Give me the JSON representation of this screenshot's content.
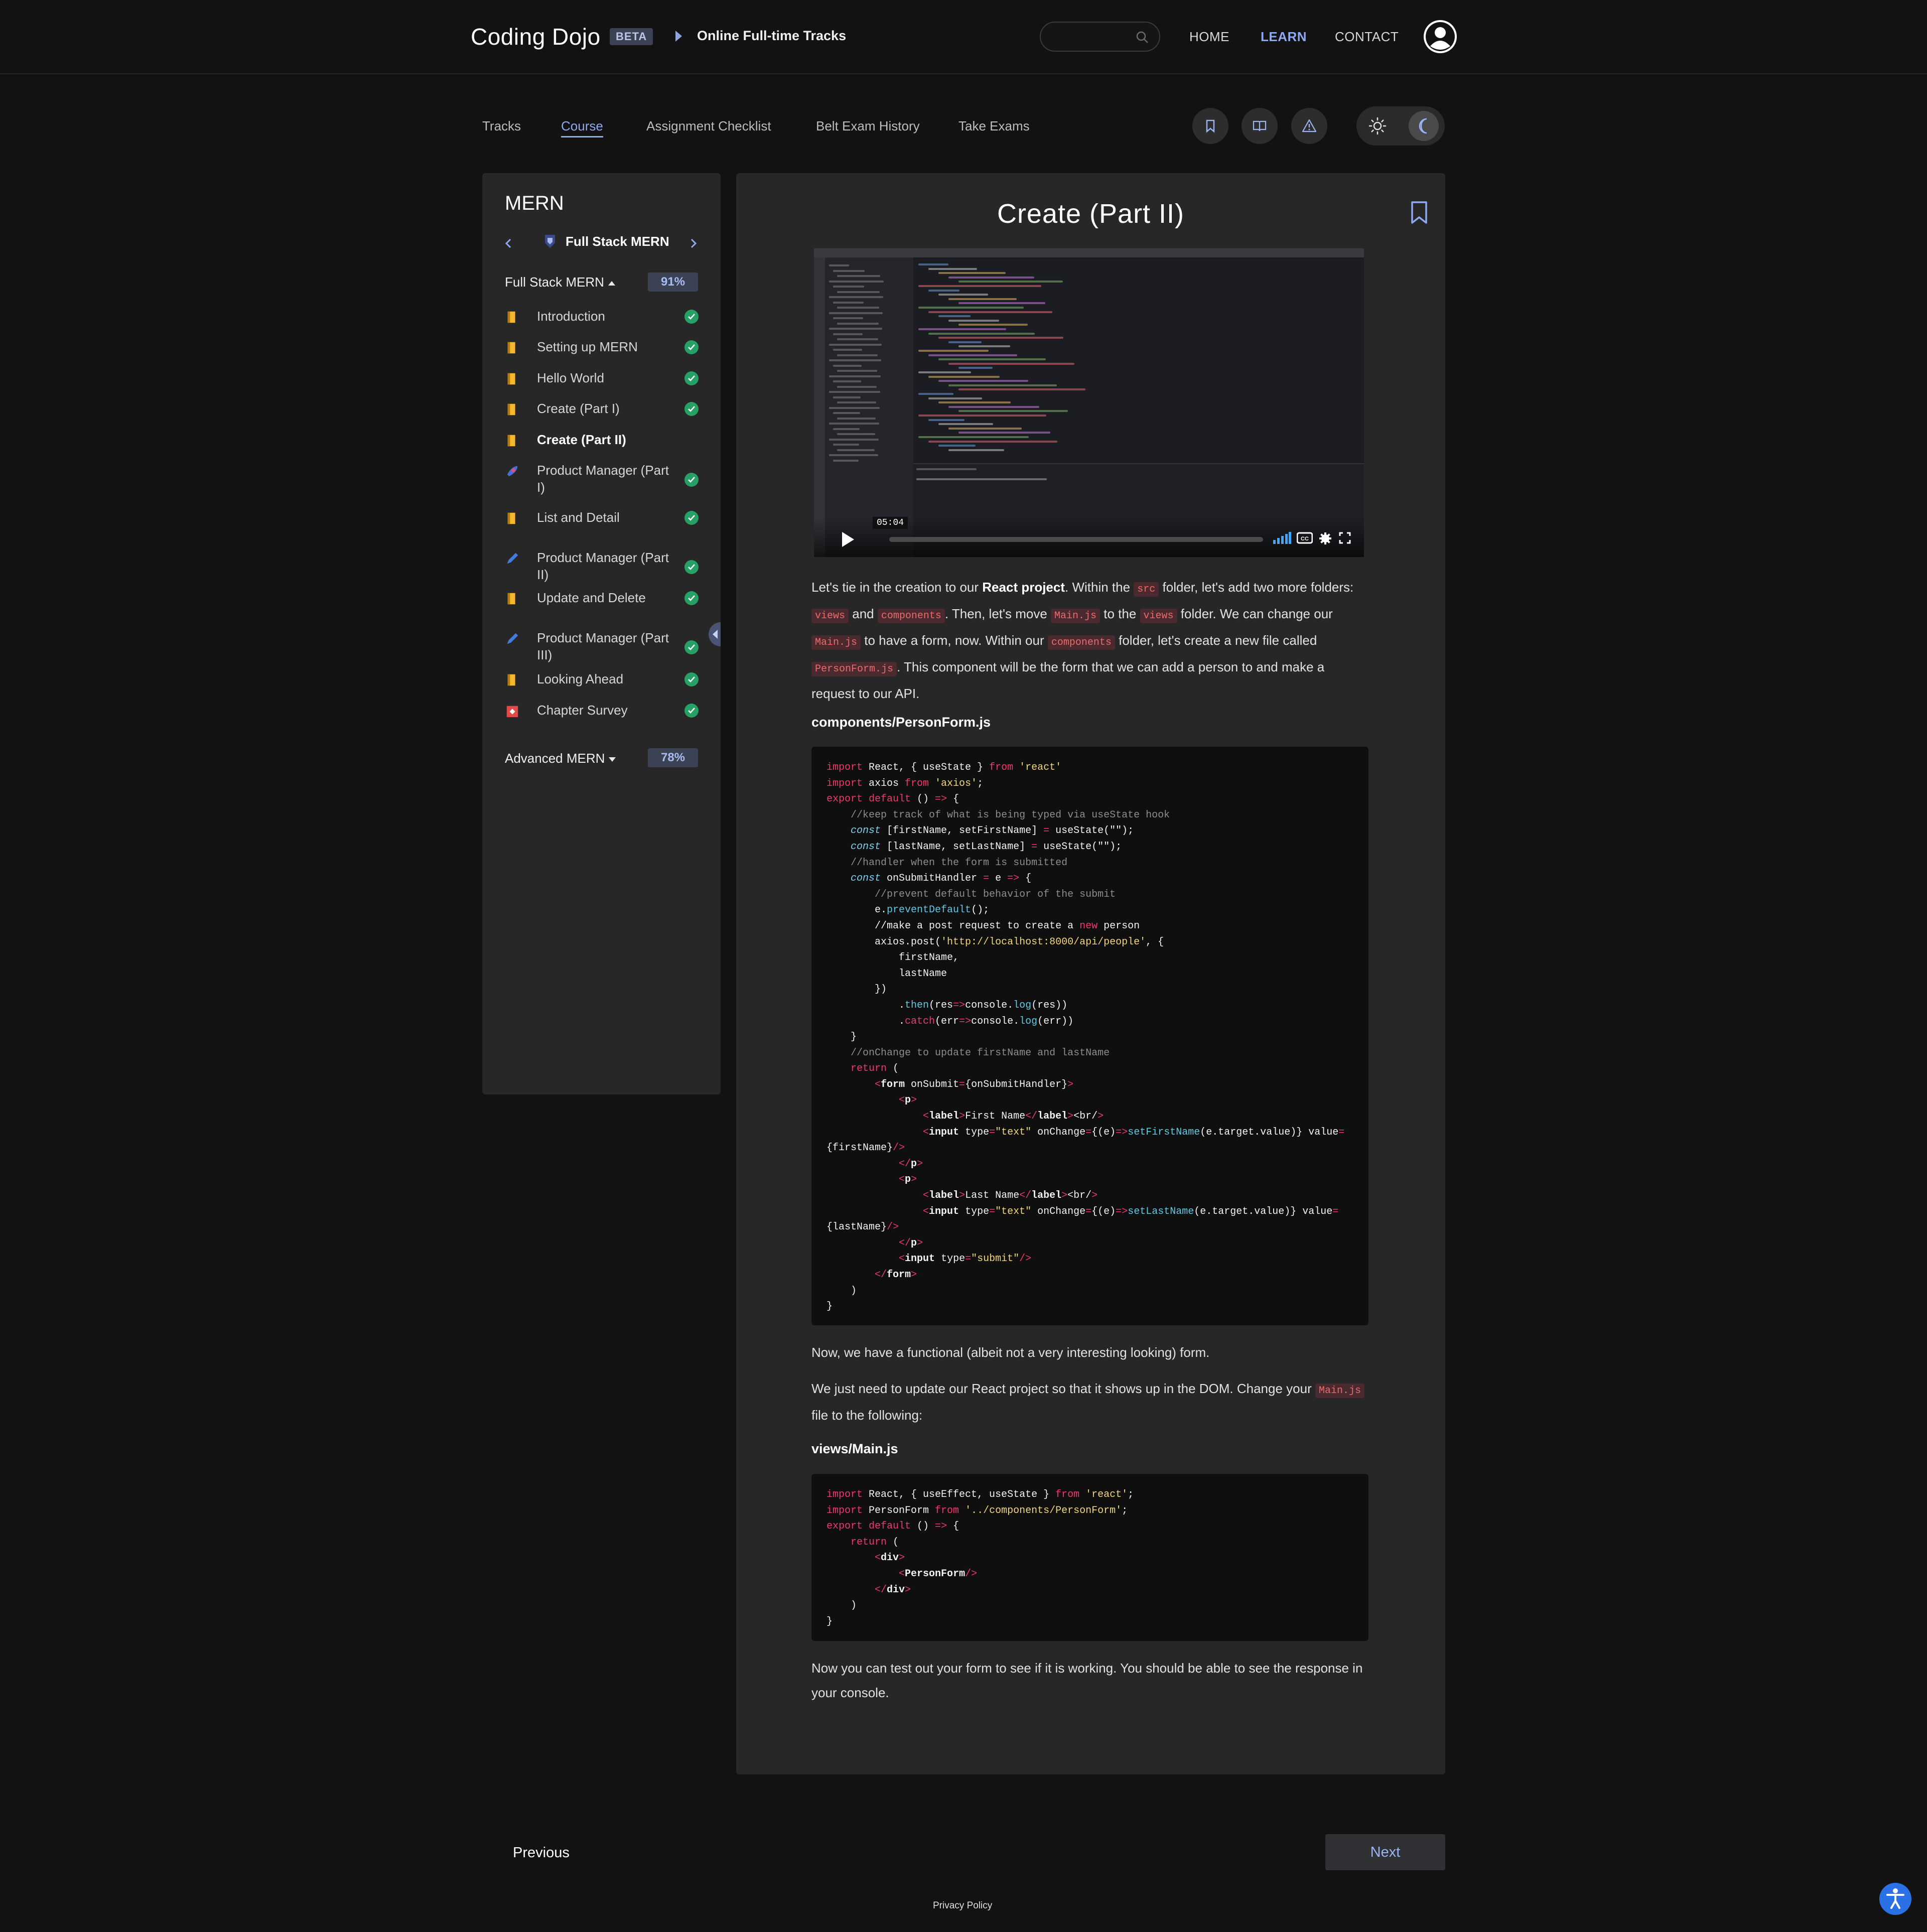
{
  "header": {
    "logo": "Coding Dojo",
    "badge": "BETA",
    "breadcrumb": "Online Full-time Tracks",
    "search": {
      "placeholder": "",
      "value": ""
    },
    "nav": [
      "HOME",
      "LEARN",
      "CONTACT"
    ],
    "active_nav": "LEARN"
  },
  "subnav": {
    "tabs": [
      "Tracks",
      "Course",
      "Assignment Checklist",
      "Belt Exam History",
      "Take Exams"
    ],
    "active_tab": "Course",
    "icons": [
      "bookmark-icon",
      "book-icon",
      "warning-icon"
    ],
    "theme": {
      "options": [
        "sun-icon",
        "moon-icon"
      ],
      "selected": "dark"
    }
  },
  "sidebar": {
    "title": "MERN",
    "track": "Full Stack MERN",
    "groups": [
      {
        "label": "Full Stack MERN",
        "percent": "91%",
        "expanded": true
      },
      {
        "label": "Advanced MERN",
        "percent": "78%",
        "expanded": false
      }
    ],
    "lessons": [
      {
        "label": "Introduction",
        "icon": "book-icon",
        "done": true
      },
      {
        "label": "Setting up MERN",
        "icon": "book-icon",
        "done": true
      },
      {
        "label": "Hello World",
        "icon": "book-icon",
        "done": true
      },
      {
        "label": "Create (Part I)",
        "icon": "book-icon",
        "done": true
      },
      {
        "label": "Create (Part II)",
        "icon": "book-icon",
        "done": false,
        "current": true
      },
      {
        "label": "Product Manager (Part I)",
        "icon": "rocket-icon",
        "done": true
      },
      {
        "label": "List and Detail",
        "icon": "book-icon",
        "done": true
      },
      {
        "label": "Product Manager (Part II)",
        "icon": "pencil-icon",
        "done": true
      },
      {
        "label": "Update and Delete",
        "icon": "book-icon",
        "done": true
      },
      {
        "label": "Product Manager (Part III)",
        "icon": "pencil-icon",
        "done": true
      },
      {
        "label": "Looking Ahead",
        "icon": "book-icon",
        "done": true
      },
      {
        "label": "Chapter Survey",
        "icon": "survey-icon",
        "done": true
      }
    ]
  },
  "content": {
    "title": "Create (Part II)",
    "video": {
      "time": "05:04",
      "playing": false
    },
    "para1": {
      "t1": "Let's tie in the creation to our ",
      "b1": "React project",
      "t2": ". Within the ",
      "c1": "src",
      "t3": " folder, let's add two more folders: ",
      "c2": "views",
      "t4": " and ",
      "c3": "components",
      "t5": ". Then, let's move ",
      "c4": "Main.js",
      "t6": " to the ",
      "c5": "views",
      "t7": " folder. We can change our ",
      "c6": "Main.js",
      "t8": " to have a form, now. Within our ",
      "c7": "components",
      "t9": " folder, let's create a new file called ",
      "c8": "PersonForm.js",
      "t10": ". This component will be the form that we can add a person to and make a request to our API."
    },
    "file1": "components/PersonForm.js",
    "code1": [
      [
        [
          "k",
          "import"
        ],
        [
          "p",
          " React, { useState } "
        ],
        [
          "k",
          "from"
        ],
        [
          "s",
          " 'react'"
        ]
      ],
      [
        [
          "k",
          "import"
        ],
        [
          "p",
          " axios "
        ],
        [
          "k",
          "from"
        ],
        [
          "s",
          " 'axios'"
        ],
        [
          "p",
          ";"
        ]
      ],
      [
        [
          "k",
          "export"
        ],
        [
          "k",
          " default"
        ],
        [
          "p",
          " () "
        ],
        [
          "k",
          "=>"
        ],
        [
          "p",
          " {"
        ]
      ],
      [
        [
          "p",
          "    "
        ],
        [
          "c",
          "//keep track of what is being typed via useState hook"
        ]
      ],
      [
        [
          "p",
          "    "
        ],
        [
          "v",
          "const"
        ],
        [
          "p",
          " [firstName, setFirstName] "
        ],
        [
          "k",
          "="
        ],
        [
          "p",
          " useState(\"\");"
        ]
      ],
      [
        [
          "p",
          "    "
        ],
        [
          "v",
          "const"
        ],
        [
          "p",
          " [lastName, setLastName] "
        ],
        [
          "k",
          "="
        ],
        [
          "p",
          " useState(\"\");"
        ]
      ],
      [
        [
          "p",
          "    "
        ],
        [
          "c",
          "//handler when the form is submitted"
        ]
      ],
      [
        [
          "p",
          "    "
        ],
        [
          "v",
          "const"
        ],
        [
          "p",
          " onSubmitHandler "
        ],
        [
          "k",
          "="
        ],
        [
          "p",
          " e "
        ],
        [
          "k",
          "=>"
        ],
        [
          "p",
          " {"
        ]
      ],
      [
        [
          "p",
          "        "
        ],
        [
          "c",
          "//prevent default behavior of the submit"
        ]
      ],
      [
        [
          "p",
          "        e."
        ],
        [
          "f",
          "preventDefault"
        ],
        [
          "p",
          "();"
        ]
      ],
      [
        [
          "p",
          "        //make a post request to create a "
        ],
        [
          "k",
          "new"
        ],
        [
          "p",
          " person"
        ]
      ],
      [
        [
          "p",
          "        axios.post("
        ],
        [
          "s",
          "'http://localhost:8000/api/people'"
        ],
        [
          "p",
          ", {"
        ]
      ],
      [
        [
          "p",
          "            firstName,"
        ]
      ],
      [
        [
          "p",
          "            lastName"
        ]
      ],
      [
        [
          "p",
          "        })"
        ]
      ],
      [
        [
          "p",
          "            ."
        ],
        [
          "f",
          "then"
        ],
        [
          "p",
          "(res"
        ],
        [
          "k",
          "=>"
        ],
        [
          "p",
          "console."
        ],
        [
          "f",
          "log"
        ],
        [
          "p",
          "(res))"
        ]
      ],
      [
        [
          "p",
          "            ."
        ],
        [
          "k",
          "catch"
        ],
        [
          "p",
          "(err"
        ],
        [
          "k",
          "=>"
        ],
        [
          "p",
          "console."
        ],
        [
          "f",
          "log"
        ],
        [
          "p",
          "(err))"
        ]
      ],
      [
        [
          "p",
          "    }"
        ]
      ],
      [
        [
          "p",
          "    "
        ],
        [
          "c",
          "//onChange to update firstName and lastName"
        ]
      ],
      [
        [
          "p",
          "    "
        ],
        [
          "k",
          "return"
        ],
        [
          "p",
          " ("
        ]
      ],
      [
        [
          "p",
          "        "
        ],
        [
          "k",
          "<"
        ],
        [
          "t",
          "form"
        ],
        [
          "p",
          " onSubmit"
        ],
        [
          "k",
          "="
        ],
        [
          "p",
          "{onSubmitHandler}"
        ],
        [
          "k",
          ">"
        ]
      ],
      [
        [
          "p",
          "            "
        ],
        [
          "k",
          "<"
        ],
        [
          "t",
          "p"
        ],
        [
          "k",
          ">"
        ]
      ],
      [
        [
          "p",
          "                "
        ],
        [
          "k",
          "<"
        ],
        [
          "t",
          "label"
        ],
        [
          "k",
          ">"
        ],
        [
          "p",
          "First Name"
        ],
        [
          "k",
          "</"
        ],
        [
          "t",
          "label"
        ],
        [
          "k",
          ">"
        ],
        [
          "p",
          "<br/"
        ],
        [
          "k",
          ">"
        ]
      ],
      [
        [
          "p",
          "                "
        ],
        [
          "k",
          "<"
        ],
        [
          "t",
          "input"
        ],
        [
          "p",
          " type"
        ],
        [
          "k",
          "="
        ],
        [
          "s",
          "\"text\""
        ],
        [
          "p",
          " onChange"
        ],
        [
          "k",
          "="
        ],
        [
          "p",
          "{(e)"
        ],
        [
          "k",
          "=>"
        ],
        [
          "f",
          "setFirstName"
        ],
        [
          "p",
          "(e.target.value)} value"
        ],
        [
          "k",
          "="
        ]
      ],
      [
        [
          "p",
          "{firstName}"
        ],
        [
          "k",
          "/>"
        ]
      ],
      [
        [
          "p",
          "            "
        ],
        [
          "k",
          "</"
        ],
        [
          "t",
          "p"
        ],
        [
          "k",
          ">"
        ]
      ],
      [
        [
          "p",
          "            "
        ],
        [
          "k",
          "<"
        ],
        [
          "t",
          "p"
        ],
        [
          "k",
          ">"
        ]
      ],
      [
        [
          "p",
          "                "
        ],
        [
          "k",
          "<"
        ],
        [
          "t",
          "label"
        ],
        [
          "k",
          ">"
        ],
        [
          "p",
          "Last Name"
        ],
        [
          "k",
          "</"
        ],
        [
          "t",
          "label"
        ],
        [
          "k",
          ">"
        ],
        [
          "p",
          "<br/"
        ],
        [
          "k",
          ">"
        ]
      ],
      [
        [
          "p",
          "                "
        ],
        [
          "k",
          "<"
        ],
        [
          "t",
          "input"
        ],
        [
          "p",
          " type"
        ],
        [
          "k",
          "="
        ],
        [
          "s",
          "\"text\""
        ],
        [
          "p",
          " onChange"
        ],
        [
          "k",
          "="
        ],
        [
          "p",
          "{(e)"
        ],
        [
          "k",
          "=>"
        ],
        [
          "f",
          "setLastName"
        ],
        [
          "p",
          "(e.target.value)} value"
        ],
        [
          "k",
          "="
        ]
      ],
      [
        [
          "p",
          "{lastName}"
        ],
        [
          "k",
          "/>"
        ]
      ],
      [
        [
          "p",
          "            "
        ],
        [
          "k",
          "</"
        ],
        [
          "t",
          "p"
        ],
        [
          "k",
          ">"
        ]
      ],
      [
        [
          "p",
          "            "
        ],
        [
          "k",
          "<"
        ],
        [
          "t",
          "input"
        ],
        [
          "p",
          " type"
        ],
        [
          "k",
          "="
        ],
        [
          "s",
          "\"submit\""
        ],
        [
          "k",
          "/>"
        ]
      ],
      [
        [
          "p",
          "        "
        ],
        [
          "k",
          "</"
        ],
        [
          "t",
          "form"
        ],
        [
          "k",
          ">"
        ]
      ],
      [
        [
          "p",
          "    )"
        ]
      ],
      [
        [
          "p",
          "}"
        ]
      ]
    ],
    "para2": "Now, we have a functional (albeit not a very interesting looking) form.",
    "para3": {
      "t1": "We just need to update our React project so that it shows up in the DOM. Change your ",
      "c1": "Main.js",
      "t2": " file to the following:"
    },
    "file2": "views/Main.js",
    "code2": [
      [
        [
          "k",
          "import"
        ],
        [
          "p",
          " React, { useEffect, useState } "
        ],
        [
          "k",
          "from"
        ],
        [
          "s",
          " 'react'"
        ],
        [
          "p",
          ";"
        ]
      ],
      [
        [
          "k",
          "import"
        ],
        [
          "p",
          " PersonForm "
        ],
        [
          "k",
          "from"
        ],
        [
          "s",
          " '../components/PersonForm'"
        ],
        [
          "p",
          ";"
        ]
      ],
      [
        [
          "k",
          "export"
        ],
        [
          "k",
          " default"
        ],
        [
          "p",
          " () "
        ],
        [
          "k",
          "=>"
        ],
        [
          "p",
          " {"
        ]
      ],
      [
        [
          "p",
          "    "
        ],
        [
          "k",
          "return"
        ],
        [
          "p",
          " ("
        ]
      ],
      [
        [
          "p",
          "        "
        ],
        [
          "k",
          "<"
        ],
        [
          "t",
          "div"
        ],
        [
          "k",
          ">"
        ]
      ],
      [
        [
          "p",
          "            "
        ],
        [
          "k",
          "<"
        ],
        [
          "t",
          "PersonForm"
        ],
        [
          "k",
          "/>"
        ]
      ],
      [
        [
          "p",
          "        "
        ],
        [
          "k",
          "</"
        ],
        [
          "t",
          "div"
        ],
        [
          "k",
          ">"
        ]
      ],
      [
        [
          "p",
          "    )"
        ]
      ],
      [
        [
          "p",
          "}"
        ]
      ]
    ],
    "para4": "Now you can test out your form to see if it is working. You should be able to see the response in your console."
  },
  "footer": {
    "previous": "Previous",
    "next": "Next",
    "privacy": "Privacy Policy",
    "accessibility_icon": "accessibility-icon"
  },
  "colors": {
    "accent": "#8fa8f2",
    "done": "#26a065",
    "inline_code": "#ec6b6b"
  }
}
